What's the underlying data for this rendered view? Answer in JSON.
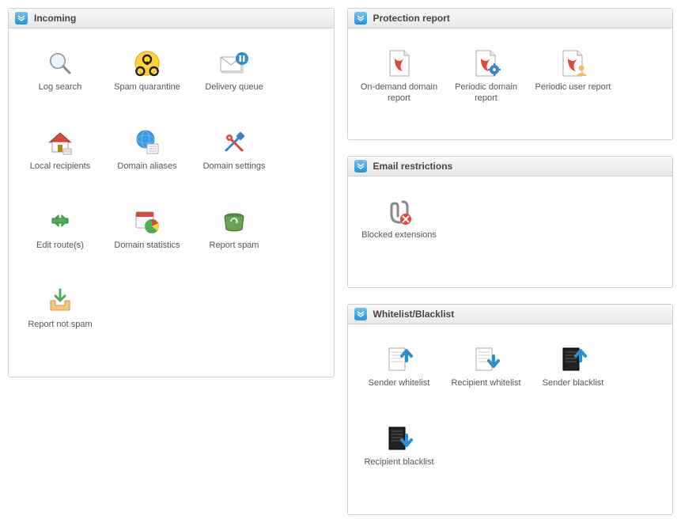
{
  "panels": {
    "incoming": {
      "title": "Incoming",
      "items": [
        {
          "label": "Log search"
        },
        {
          "label": "Spam quarantine"
        },
        {
          "label": "Delivery queue"
        },
        {
          "label": "Local recipients"
        },
        {
          "label": "Domain aliases"
        },
        {
          "label": "Domain settings"
        },
        {
          "label": "Edit route(s)"
        },
        {
          "label": "Domain statistics"
        },
        {
          "label": "Report spam"
        },
        {
          "label": "Report not spam"
        }
      ]
    },
    "protection": {
      "title": "Protection report",
      "items": [
        {
          "label": "On-demand domain report"
        },
        {
          "label": "Periodic domain report"
        },
        {
          "label": "Periodic user report"
        }
      ]
    },
    "restrictions": {
      "title": "Email restrictions",
      "items": [
        {
          "label": "Blocked extensions"
        }
      ]
    },
    "whitelist": {
      "title": "Whitelist/Blacklist",
      "items": [
        {
          "label": "Sender whitelist"
        },
        {
          "label": "Recipient whitelist"
        },
        {
          "label": "Sender blacklist"
        },
        {
          "label": "Recipient blacklist"
        }
      ]
    }
  }
}
